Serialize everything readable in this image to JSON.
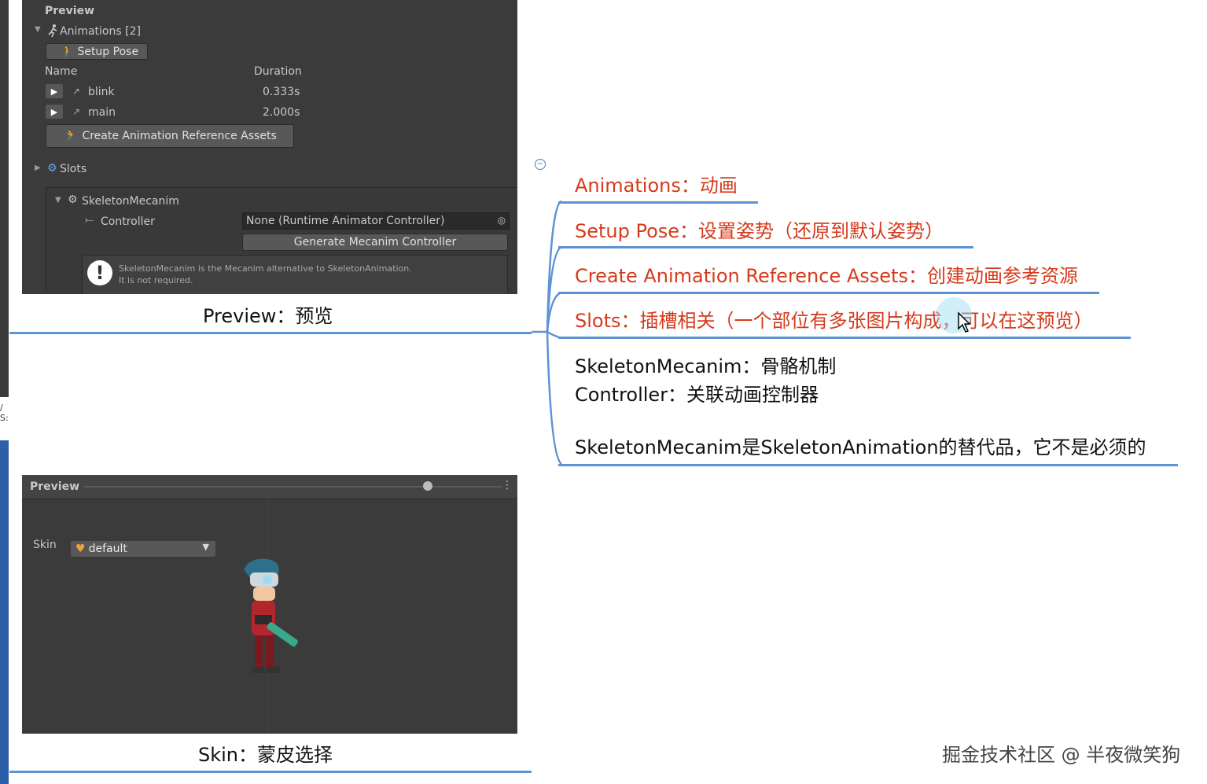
{
  "top_panel": {
    "title": "Preview",
    "animations_label": "Animations [2]",
    "setup_pose": "Setup Pose",
    "col_name": "Name",
    "col_duration": "Duration",
    "animations": [
      {
        "name": "blink",
        "duration": "0.333s"
      },
      {
        "name": "main",
        "duration": "2.000s"
      }
    ],
    "create_assets": "Create Animation Reference Assets",
    "slots": "Slots",
    "skeleton_mecanim": "SkeletonMecanim",
    "controller_label": "Controller",
    "controller_value": "None (Runtime Animator Controller)",
    "generate_button": "Generate Mecanim Controller",
    "help_line1": "SkeletonMecanim is the Mecanim alternative to SkeletonAnimation.",
    "help_line2": "It is not required."
  },
  "caption_top": "Preview：预览",
  "bottom_panel": {
    "title": "Preview",
    "skin_label": "Skin",
    "skin_value": "default"
  },
  "caption_bottom": "Skin：蒙皮选择",
  "mindmap": {
    "nodes": [
      "Animations：动画",
      "Setup Pose：设置姿势（还原到默认姿势）",
      "Create Animation Reference Assets：创建动画参考资源",
      "Slots：插槽相关（一个部位有多张图片构成，可以在这预览）",
      "SkeletonMecanim：骨骼机制",
      "Controller：关联动画控制器",
      "SkeletonMecanim是SkeletonAnimation的替代品，它不是必须的"
    ],
    "colors": {
      "highlight": "#d63a1b",
      "line": "#5b93d4"
    }
  },
  "watermark": "掘金技术社区 @ 半夜微笑狗"
}
